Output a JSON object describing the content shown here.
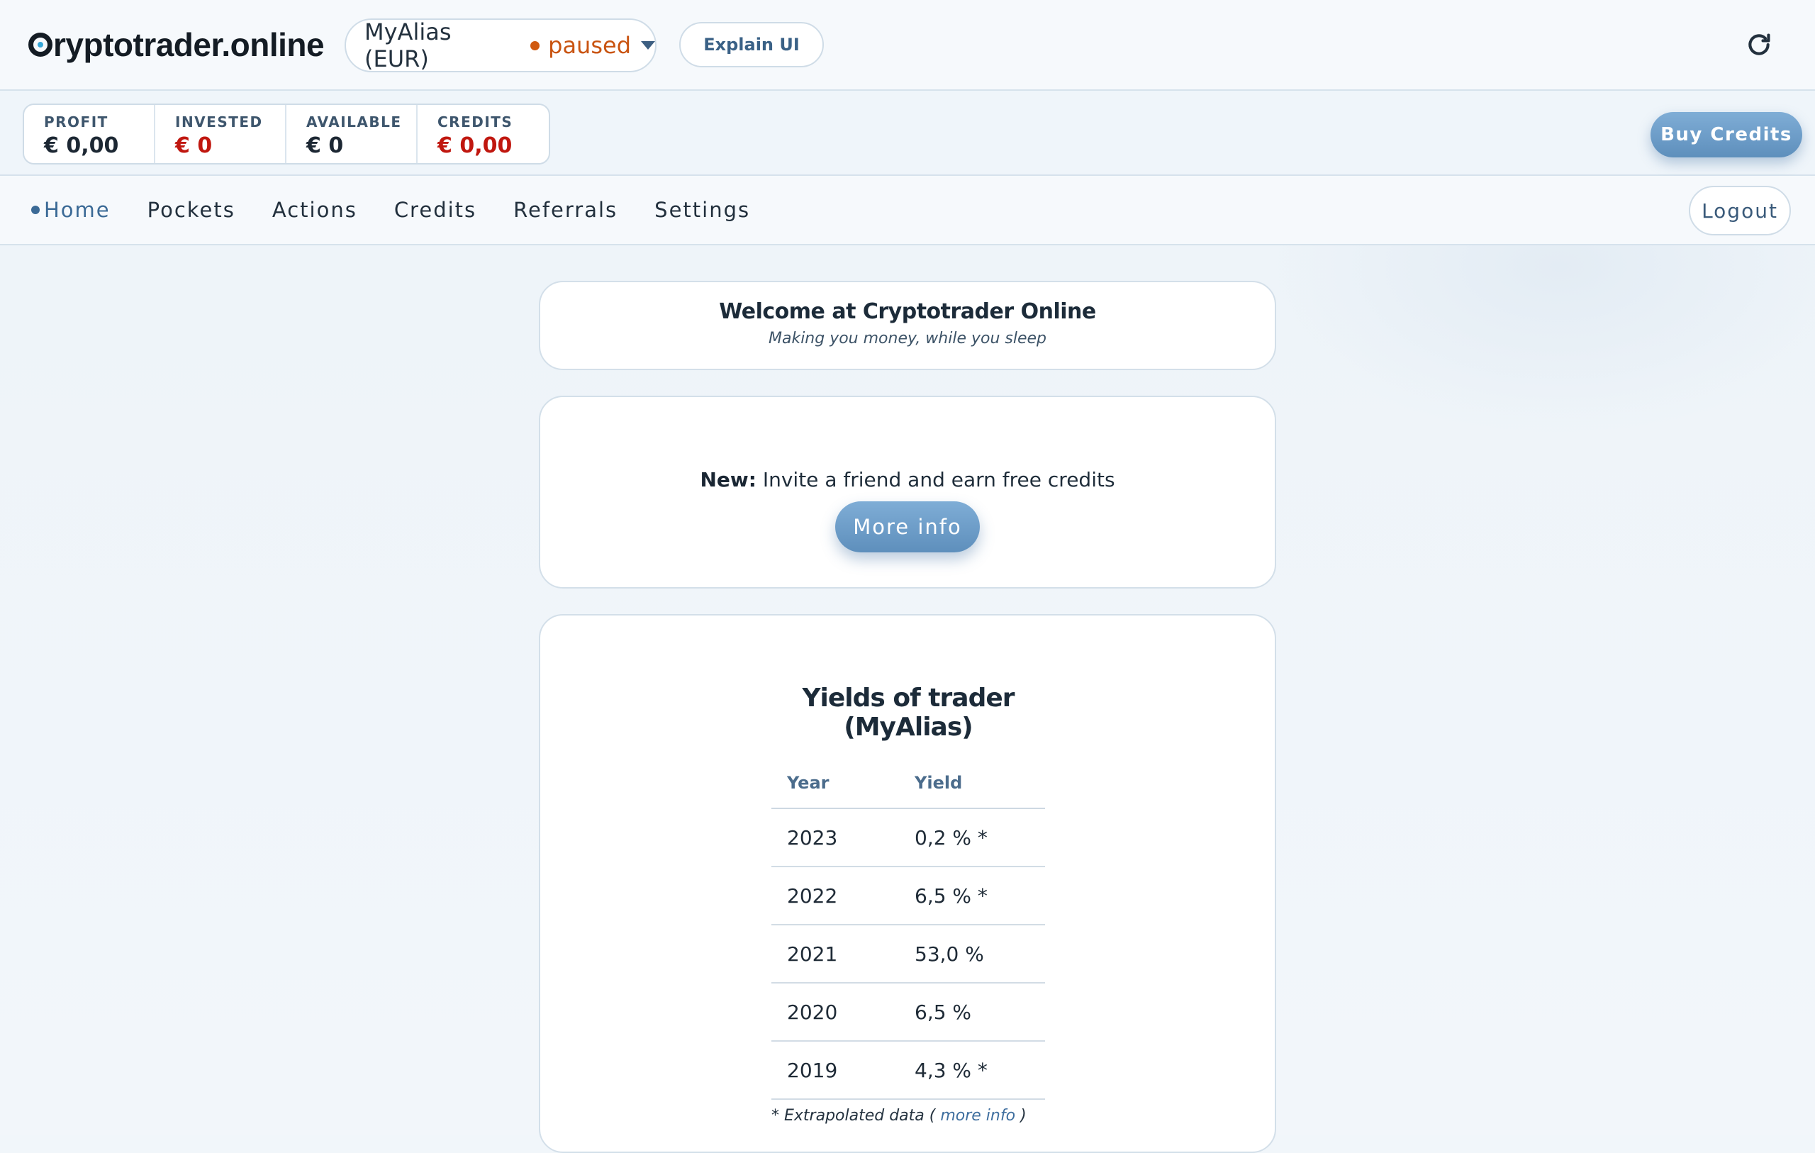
{
  "brand": {
    "name": "ryptotrader.online",
    "logo": "cryptotrader-logo"
  },
  "trader_select": {
    "alias": "MyAlias (EUR)",
    "status": "paused",
    "status_color": "#c95411"
  },
  "explain_button": {
    "label": "Explain UI"
  },
  "refresh": {
    "icon": "refresh-icon"
  },
  "stats": [
    {
      "label": "PROFIT",
      "value": "€ 0,00",
      "negative": false
    },
    {
      "label": "INVESTED",
      "value": "€ 0",
      "negative": true
    },
    {
      "label": "AVAILABLE",
      "value": "€ 0",
      "negative": false
    },
    {
      "label": "CREDITS",
      "value": "€ 0,00",
      "negative": true
    }
  ],
  "buy_credits": {
    "label": "Buy Credits"
  },
  "nav": {
    "items": [
      {
        "label": "Home",
        "active": true
      },
      {
        "label": "Pockets",
        "active": false
      },
      {
        "label": "Actions",
        "active": false
      },
      {
        "label": "Credits",
        "active": false
      },
      {
        "label": "Referrals",
        "active": false
      },
      {
        "label": "Settings",
        "active": false
      }
    ],
    "logout": "Logout"
  },
  "welcome": {
    "title": "Welcome at Cryptotrader Online",
    "subtitle": "Making you money, while you sleep"
  },
  "invite": {
    "prefix": "New:",
    "text": " Invite a friend and earn free credits",
    "button": "More info"
  },
  "yields": {
    "title": "Yields of trader (MyAlias)",
    "headers": {
      "year": "Year",
      "yield": "Yield"
    },
    "rows": [
      {
        "year": "2023",
        "yield": "0,2 % *"
      },
      {
        "year": "2022",
        "yield": "6,5 % *"
      },
      {
        "year": "2021",
        "yield": "53,0 %"
      },
      {
        "year": "2020",
        "yield": "6,5 %"
      },
      {
        "year": "2019",
        "yield": "4,3 % *"
      }
    ],
    "footnote_prefix": "* Extrapolated data (",
    "footnote_link": " more info ",
    "footnote_suffix": ")"
  },
  "colors": {
    "accent": "#3b6a96",
    "negative": "#c0170f",
    "button_gradient_top": "#7fadd6",
    "button_gradient_bottom": "#5e8fbc"
  }
}
